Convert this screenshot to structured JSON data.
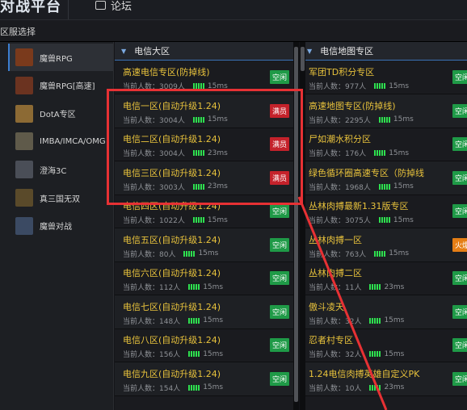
{
  "topbar": {
    "logo": "对战平台",
    "forum_label": "论坛"
  },
  "subbar": {
    "label": "区服选择"
  },
  "sidebar": {
    "items": [
      {
        "label": "魔兽RPG",
        "active": true,
        "thumb_color": "#7a3a1c"
      },
      {
        "label": "魔兽RPG[高速]",
        "active": false,
        "thumb_color": "#6b3320"
      },
      {
        "label": "DotA专区",
        "active": false,
        "thumb_color": "#8c6a34"
      },
      {
        "label": "IMBA/IMCA/OMG",
        "active": false,
        "thumb_color": "#5f5a4a"
      },
      {
        "label": "澄海3C",
        "active": false,
        "thumb_color": "#4a4e57"
      },
      {
        "label": "真三国无双",
        "active": false,
        "thumb_color": "#5a4a2a"
      },
      {
        "label": "魔兽对战",
        "active": false,
        "thumb_color": "#3b4a63"
      }
    ]
  },
  "columns": {
    "left": {
      "title": "电信大区",
      "servers": [
        {
          "name": "高速电信专区(防掉线)",
          "count": "当前人数：3009人",
          "ping": "15ms",
          "status": "空闲",
          "status_type": "free"
        },
        {
          "name": "电信一区(自动升级1.24)",
          "count": "当前人数：3004人",
          "ping": "15ms",
          "status": "满员",
          "status_type": "full"
        },
        {
          "name": "电信二区(自动升级1.24)",
          "count": "当前人数：3004人",
          "ping": "23ms",
          "status": "满员",
          "status_type": "full"
        },
        {
          "name": "电信三区(自动升级1.24)",
          "count": "当前人数：3003人",
          "ping": "23ms",
          "status": "满员",
          "status_type": "full"
        },
        {
          "name": "电信四区(自动升级1.24)",
          "count": "当前人数：1022人",
          "ping": "15ms",
          "status": "空闲",
          "status_type": "free"
        },
        {
          "name": "电信五区(自动升级1.24)",
          "count": "当前人数：80人",
          "ping": "15ms",
          "status": "空闲",
          "status_type": "free"
        },
        {
          "name": "电信六区(自动升级1.24)",
          "count": "当前人数：112人",
          "ping": "15ms",
          "status": "空闲",
          "status_type": "free"
        },
        {
          "name": "电信七区(自动升级1.24)",
          "count": "当前人数：148人",
          "ping": "15ms",
          "status": "空闲",
          "status_type": "free"
        },
        {
          "name": "电信八区(自动升级1.24)",
          "count": "当前人数：156人",
          "ping": "15ms",
          "status": "空闲",
          "status_type": "free"
        },
        {
          "name": "电信九区(自动升级1.24)",
          "count": "当前人数：154人",
          "ping": "15ms",
          "status": "空闲",
          "status_type": "free"
        }
      ]
    },
    "right": {
      "title": "电信地图专区",
      "servers": [
        {
          "name": "军团TD积分专区",
          "count": "当前人数：977人",
          "ping": "15ms",
          "status": "空闲",
          "status_type": "free"
        },
        {
          "name": "高速地图专区(防掉线)",
          "count": "当前人数：2295人",
          "ping": "15ms",
          "status": "空闲",
          "status_type": "free"
        },
        {
          "name": "尸如潮水积分区",
          "count": "当前人数：176人",
          "ping": "15ms",
          "status": "空闲",
          "status_type": "free"
        },
        {
          "name": "绿色循环圈高速专区（防掉线",
          "count": "当前人数：1968人",
          "ping": "15ms",
          "status": "空闲",
          "status_type": "free"
        },
        {
          "name": "丛林肉搏最新1.31版专区",
          "count": "当前人数：3075人",
          "ping": "15ms",
          "status": "空闲",
          "status_type": "free"
        },
        {
          "name": "丛林肉搏一区",
          "count": "当前人数：763人",
          "ping": "15ms",
          "status": "火爆",
          "status_type": "hot"
        },
        {
          "name": "丛林肉搏二区",
          "count": "当前人数：11人",
          "ping": "23ms",
          "status": "空闲",
          "status_type": "free"
        },
        {
          "name": "傲斗凌天",
          "count": "当前人数：32人",
          "ping": "15ms",
          "status": "空闲",
          "status_type": "free"
        },
        {
          "name": "忍者村专区",
          "count": "当前人数：32人",
          "ping": "15ms",
          "status": "空闲",
          "status_type": "free"
        },
        {
          "name": "1.24电信肉搏英雄自定义PK",
          "count": "当前人数：10人",
          "ping": "23ms",
          "status": "空闲",
          "status_type": "free"
        }
      ]
    }
  },
  "accent_colors": {
    "highlight": "#e73134",
    "server_name": "#e8c23c",
    "free": "#1f9a47",
    "full": "#c4222b",
    "hot": "#e57e15"
  }
}
